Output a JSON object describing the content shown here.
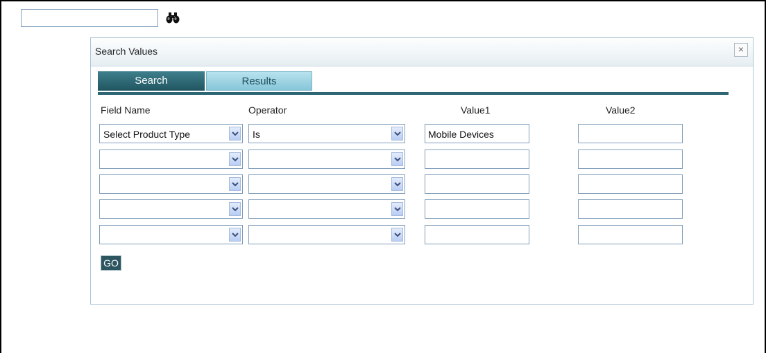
{
  "top_search": {
    "value": ""
  },
  "dialog": {
    "title": "Search Values",
    "close_glyph": "×",
    "tabs": [
      {
        "label": "Search",
        "active": true
      },
      {
        "label": "Results",
        "active": false
      }
    ],
    "columns": {
      "field_name": "Field Name",
      "operator": "Operator",
      "value1": "Value1",
      "value2": "Value2"
    },
    "rows": [
      {
        "field": "Select Product Type",
        "operator": "Is",
        "value1": "Mobile Devices",
        "value2": ""
      },
      {
        "field": "",
        "operator": "",
        "value1": "",
        "value2": ""
      },
      {
        "field": "",
        "operator": "",
        "value1": "",
        "value2": ""
      },
      {
        "field": "",
        "operator": "",
        "value1": "",
        "value2": ""
      },
      {
        "field": "",
        "operator": "",
        "value1": "",
        "value2": ""
      }
    ],
    "go_label": "GO"
  },
  "icons": {
    "search": "binoculars-icon",
    "dropdown": "chevron-down-icon",
    "close": "close-icon"
  },
  "colors": {
    "active_tab": "#2d6574",
    "inactive_tab": "#9fd3e3",
    "go_button": "#2d5560"
  }
}
